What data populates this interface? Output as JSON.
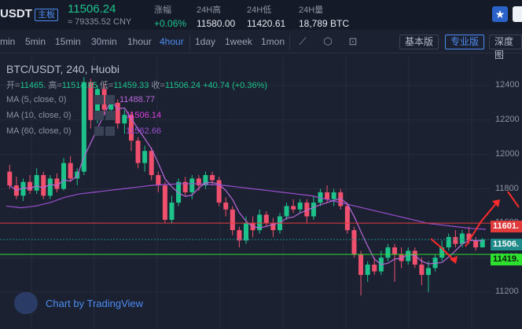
{
  "ticker": {
    "symbol": "USDT",
    "tag": "主板",
    "price": "11506.24",
    "cny": "≈ 79335.52 CNY",
    "change_label": "涨幅",
    "change_value": "+0.06%",
    "high_label": "24H高",
    "high_value": "11580.00",
    "low_label": "24H低",
    "low_value": "11420.61",
    "volume_label": "24H量",
    "volume_value": "18,789 BTC",
    "star_icon": "star-icon",
    "colors": {
      "up": "#1ec38b",
      "down": "#f0506e",
      "accent": "#4d8cf0"
    }
  },
  "toolbar": {
    "intervals": [
      "min",
      "5min",
      "15min",
      "30min",
      "1hour",
      "4hour",
      "1day",
      "1week",
      "1mon"
    ],
    "active_interval": "4hour",
    "icons": [
      "indicator-icon",
      "settings-hex-icon",
      "screenshot-icon"
    ],
    "basic_label": "基本版",
    "pro_label": "专业版",
    "depth_label": "深度图"
  },
  "chart": {
    "title": "BTC/USDT, 240, Huobi",
    "ohlc": {
      "open_label": "开=",
      "open": "11465.",
      "high_label": "高=",
      "high": "11514.65",
      "low_label": "低=",
      "low": "11459.33",
      "close_label": "收=",
      "close": "11506.24",
      "change": "+40.74 (+0.36%)"
    },
    "ma": [
      {
        "label": "MA (5, close, 0)",
        "value": "11488.77",
        "color": "#b868d8"
      },
      {
        "label": "MA (10, close, 0)",
        "value": "11506.14",
        "color": "#e040e0"
      },
      {
        "label": "MA (60, close, 0)",
        "value": "11562.66",
        "color": "#9b4fd0"
      }
    ],
    "watermark": "Chart by TradingView",
    "axis": [
      "12400",
      "12200",
      "12000",
      "11800",
      "11600",
      "11400",
      "11200"
    ],
    "resistance_label": "11601.",
    "current_label": "11506.",
    "support_label": "11419.",
    "resistance_color": "#e03a3a",
    "current_color": "#1e8a8a",
    "support_color": "#2ee02e"
  },
  "chart_data": {
    "type": "line",
    "title": "BTC/USDT, 240, Huobi",
    "xlabel": "",
    "ylabel": "",
    "ylim": [
      11150,
      12450
    ],
    "y_ticks": [
      11200,
      11400,
      11600,
      11800,
      12000,
      12200,
      12400
    ],
    "horizontal_levels": [
      {
        "value": 11601,
        "color": "#e03a3a"
      },
      {
        "value": 11506,
        "color": "#1e8a8a"
      },
      {
        "value": 11419,
        "color": "#2ee02e"
      }
    ],
    "series": [
      {
        "name": "MA (60, close, 0)",
        "values": [
          11700,
          11690,
          11700,
          11720,
          11750,
          11770,
          11780,
          11790,
          11800,
          11810,
          11820,
          11825,
          11830,
          11830,
          11825,
          11820,
          11810,
          11800,
          11790,
          11780,
          11770,
          11760,
          11740,
          11720,
          11700,
          11680,
          11660,
          11640,
          11620,
          11600,
          11590,
          11580,
          11570,
          11565
        ]
      }
    ]
  }
}
